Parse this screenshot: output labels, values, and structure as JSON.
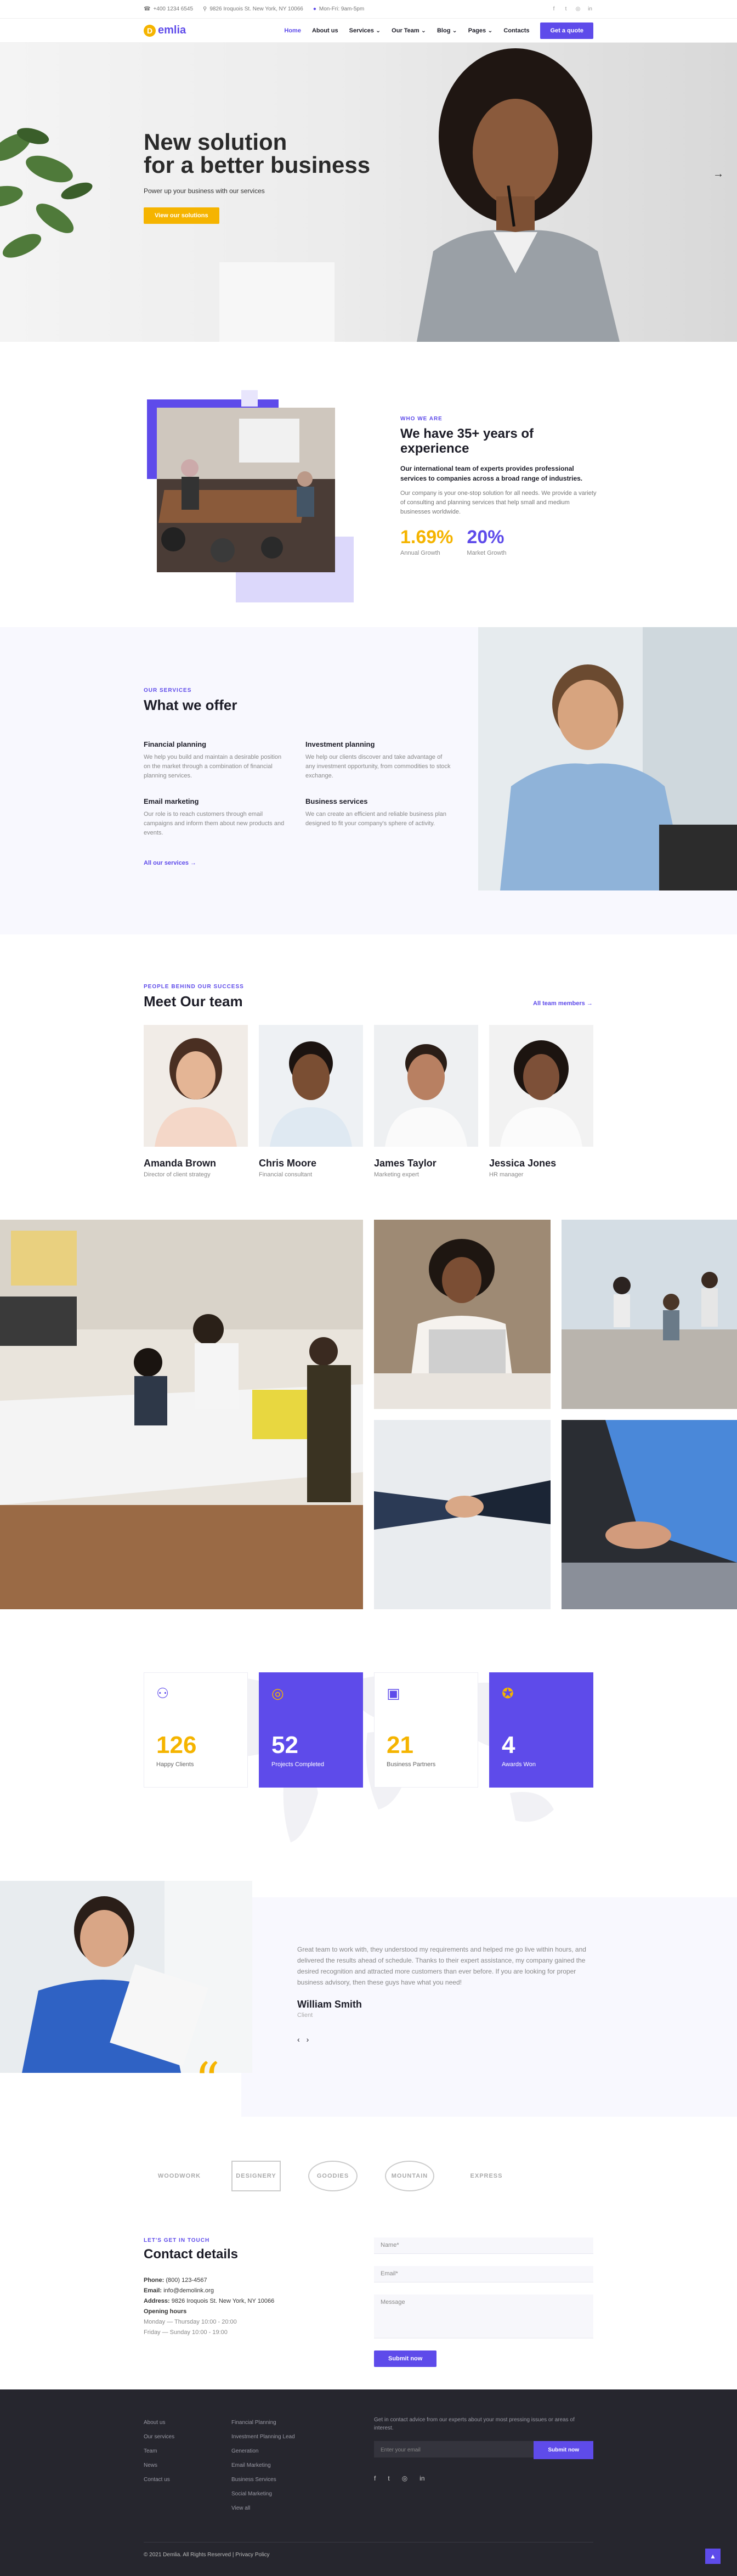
{
  "topbar": {
    "phone": "+400 1234 6545",
    "address": "9826 Iroquois St. New York, NY 10066",
    "hours": "Mon-Fri: 9am-5pm",
    "social": [
      "facebook-icon",
      "twitter-icon",
      "instagram-icon",
      "linkedin-icon"
    ]
  },
  "header": {
    "logo_mark": "D",
    "logo_text": "emlia",
    "nav": [
      "Home",
      "About us",
      "Services",
      "Our Team",
      "Blog",
      "Pages",
      "Contacts"
    ],
    "cta": "Get a quote"
  },
  "hero": {
    "title_line1": "New solution",
    "title_line2": "for a better business",
    "subtitle": "Power up your business with our services",
    "button": "View our solutions"
  },
  "about": {
    "overline": "Who we are",
    "title": "We have 35+ years of experience",
    "lead": "Our international team of experts provides professional services to companies across a broad range of industries.",
    "body": "Our company is your one-stop solution for all needs. We provide a variety of consulting and planning services that help small and medium businesses worldwide.",
    "stats": [
      {
        "value": "1.69%",
        "label": "Annual Growth"
      },
      {
        "value": "20%",
        "label": "Market Growth"
      }
    ]
  },
  "services": {
    "overline": "Our services",
    "title": "What we offer",
    "items": [
      {
        "title": "Financial planning",
        "text": "We help you build and maintain a desirable position on the market through a combination of financial planning services."
      },
      {
        "title": "Investment planning",
        "text": "We help our clients discover and take advantage of any investment opportunity, from commodities to stock exchange."
      },
      {
        "title": "Email marketing",
        "text": "Our role is to reach customers through email campaigns and inform them about new products and events."
      },
      {
        "title": "Business services",
        "text": "We can create an efficient and reliable business plan designed to fit your company's sphere of activity."
      }
    ],
    "link": "All our services  →"
  },
  "team": {
    "overline": "People behind our success",
    "title": "Meet Our team",
    "all_link": "All team members  →",
    "members": [
      {
        "name": "Amanda Brown",
        "role": "Director of client strategy"
      },
      {
        "name": "Chris Moore",
        "role": "Financial consultant"
      },
      {
        "name": "James Taylor",
        "role": "Marketing expert"
      },
      {
        "name": "Jessica Jones",
        "role": "HR manager"
      }
    ]
  },
  "counters": [
    {
      "icon": "user-icon",
      "value": "126",
      "label": "Happy Clients"
    },
    {
      "icon": "target-icon",
      "value": "52",
      "label": "Projects Completed"
    },
    {
      "icon": "briefcase-icon",
      "value": "21",
      "label": "Business Partners"
    },
    {
      "icon": "award-icon",
      "value": "4",
      "label": "Awards Won"
    }
  ],
  "testimonial": {
    "text": "Great team to work with, they understood my requirements and helped me go live within hours, and delivered the results ahead of schedule. Thanks to their expert assistance, my company gained the desired recognition and attracted more customers than ever before. If you are looking for proper business advisory, then these guys have what you need!",
    "name": "William Smith",
    "role": "Client",
    "prev": "‹",
    "next": "›"
  },
  "logos": [
    "WOODWORK",
    "DESIGNERY",
    "GOODIES",
    "MOUNTAIN",
    "EXPRESS"
  ],
  "contact": {
    "overline": "Let's get in touch",
    "title": "Contact details",
    "phone_label": "Phone:",
    "phone": "(800) 123-4567",
    "email_label": "Email:",
    "email": "info@demolink.org",
    "address_label": "Address:",
    "address": "9826 Iroquois St. New York, NY 10066",
    "hours_label": "Opening hours",
    "hours1": "Monday — Thursday 10:00 - 20:00",
    "hours2": "Friday — Sunday 10:00 - 19:00",
    "name_ph": "Name*",
    "email_ph": "Email*",
    "message_ph": "Message",
    "submit": "Submit now"
  },
  "footer": {
    "col1": [
      "About us",
      "Our services",
      "Team",
      "News",
      "Contact us"
    ],
    "col2": [
      "Financial Planning",
      "Investment Planning Lead",
      "Generation",
      "Email Marketing",
      "Business Services",
      "Social Marketing",
      "View all"
    ],
    "subscribe_text": "Get in contact advice from our experts about your most pressing issues or areas of interest.",
    "email_ph": "Enter your email",
    "submit": "Submit now",
    "social": [
      "facebook-icon",
      "twitter-icon",
      "instagram-icon",
      "linkedin-icon"
    ],
    "copyright": "© 2021 Demlia. All Rights Reserved | Privacy Policy"
  }
}
